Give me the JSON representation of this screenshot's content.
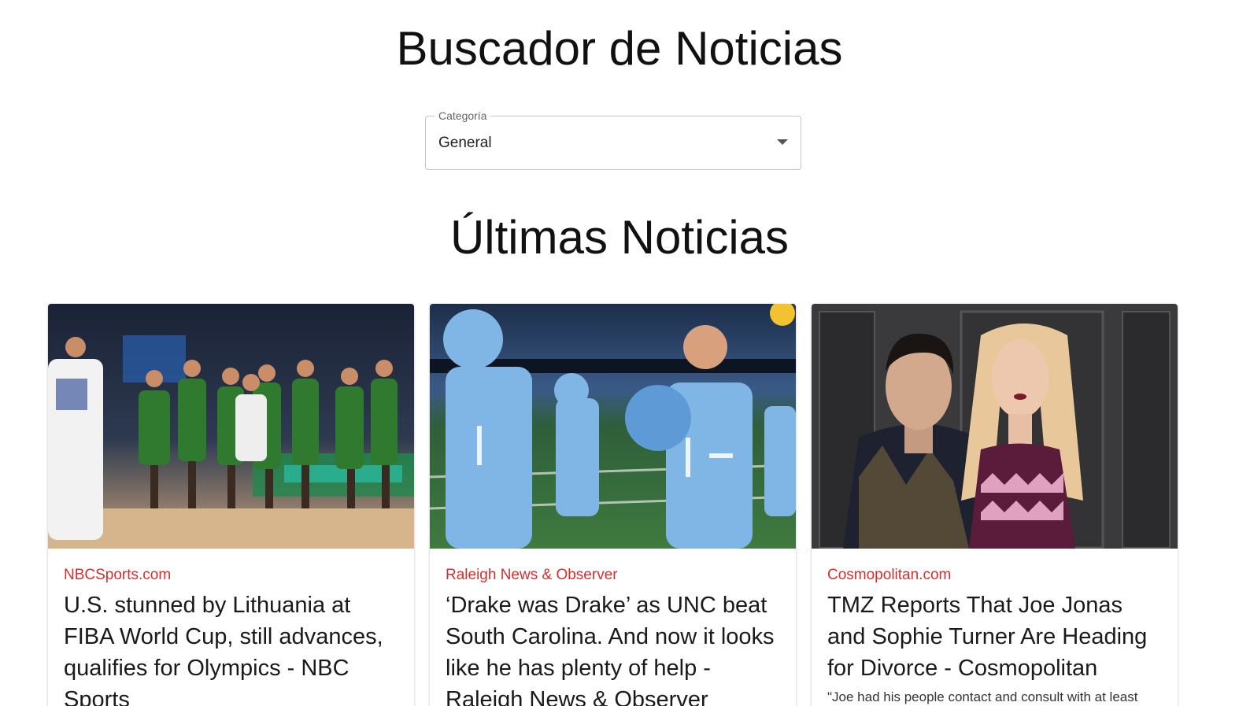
{
  "header": {
    "title": "Buscador de Noticias"
  },
  "category_select": {
    "label": "Categoría",
    "value": "General"
  },
  "news_section": {
    "title": "Últimas Noticias"
  },
  "articles": [
    {
      "source": "NBCSports.com",
      "title": "U.S. stunned by Lithuania at FIBA World Cup, still advances, qualifies for Olympics - NBC Sports",
      "image_icon": "basketball-team-photo"
    },
    {
      "source": "Raleigh News & Observer",
      "title": "‘Drake was Drake’ as UNC beat South Carolina. And now it looks like he has plenty of help - Raleigh News & Observer",
      "image_icon": "football-players-photo"
    },
    {
      "source": "Cosmopolitan.com",
      "title": "TMZ Reports That Joe Jonas and Sophie Turner Are Heading for Divorce - Cosmopolitan",
      "description": "\"Joe had his people contact and consult with at least",
      "image_icon": "couple-red-carpet-photo"
    }
  ],
  "colors": {
    "source_red": "#d32f2f",
    "border_gray": "#c4c4c4"
  }
}
